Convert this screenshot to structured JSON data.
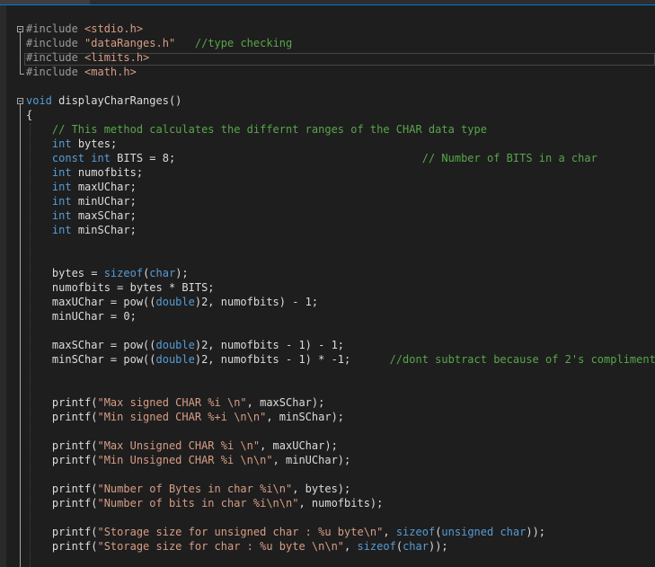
{
  "editor": {
    "language": "c",
    "lines": [
      [
        [
          "pp",
          "#include "
        ],
        [
          "str",
          "<stdio.h>"
        ]
      ],
      [
        [
          "pp",
          "#include "
        ],
        [
          "str",
          "\"dataRanges.h\""
        ],
        [
          "txt",
          "   "
        ],
        [
          "cmt",
          "//type checking"
        ]
      ],
      [
        [
          "pp",
          "#include "
        ],
        [
          "str",
          "<limits.h>"
        ]
      ],
      [
        [
          "pp",
          "#include "
        ],
        [
          "str",
          "<math.h>"
        ]
      ],
      [],
      [
        [
          "kw",
          "void"
        ],
        [
          "txt",
          " displayCharRanges()"
        ]
      ],
      [
        [
          "txt",
          "{"
        ]
      ],
      [
        [
          "txt",
          "    "
        ],
        [
          "cmt",
          "// This method calculates the differnt ranges of the CHAR data type"
        ]
      ],
      [
        [
          "txt",
          "    "
        ],
        [
          "kw",
          "int"
        ],
        [
          "txt",
          " bytes;"
        ]
      ],
      [
        [
          "txt",
          "    "
        ],
        [
          "kw",
          "const"
        ],
        [
          "txt",
          " "
        ],
        [
          "kw",
          "int"
        ],
        [
          "txt",
          " BITS = 8;                                      "
        ],
        [
          "cmt",
          "// Number of BITS in a char"
        ]
      ],
      [
        [
          "txt",
          "    "
        ],
        [
          "kw",
          "int"
        ],
        [
          "txt",
          " numofbits;"
        ]
      ],
      [
        [
          "txt",
          "    "
        ],
        [
          "kw",
          "int"
        ],
        [
          "txt",
          " maxUChar;"
        ]
      ],
      [
        [
          "txt",
          "    "
        ],
        [
          "kw",
          "int"
        ],
        [
          "txt",
          " minUChar;"
        ]
      ],
      [
        [
          "txt",
          "    "
        ],
        [
          "kw",
          "int"
        ],
        [
          "txt",
          " maxSChar;"
        ]
      ],
      [
        [
          "txt",
          "    "
        ],
        [
          "kw",
          "int"
        ],
        [
          "txt",
          " minSChar;"
        ]
      ],
      [],
      [],
      [
        [
          "txt",
          "    bytes = "
        ],
        [
          "kw",
          "sizeof"
        ],
        [
          "txt",
          "("
        ],
        [
          "kw",
          "char"
        ],
        [
          "txt",
          ");"
        ]
      ],
      [
        [
          "txt",
          "    numofbits = bytes * BITS;"
        ]
      ],
      [
        [
          "txt",
          "    maxUChar = pow(("
        ],
        [
          "kw",
          "double"
        ],
        [
          "txt",
          ")2, numofbits) - 1;"
        ]
      ],
      [
        [
          "txt",
          "    minUChar = 0;"
        ]
      ],
      [],
      [
        [
          "txt",
          "    maxSChar = pow(("
        ],
        [
          "kw",
          "double"
        ],
        [
          "txt",
          ")2, numofbits - 1) - 1;"
        ]
      ],
      [
        [
          "txt",
          "    minSChar = pow(("
        ],
        [
          "kw",
          "double"
        ],
        [
          "txt",
          ")2, numofbits - 1) * -1;      "
        ],
        [
          "cmt",
          "//dont subtract because of 2's compliment"
        ]
      ],
      [],
      [],
      [
        [
          "txt",
          "    printf("
        ],
        [
          "str",
          "\"Max signed CHAR %i \\n\""
        ],
        [
          "txt",
          ", maxSChar);"
        ]
      ],
      [
        [
          "txt",
          "    printf("
        ],
        [
          "str",
          "\"Min signed CHAR %+i \\n\\n\""
        ],
        [
          "txt",
          ", minSChar);"
        ]
      ],
      [],
      [
        [
          "txt",
          "    printf("
        ],
        [
          "str",
          "\"Max Unsigned CHAR %i \\n\""
        ],
        [
          "txt",
          ", maxUChar);"
        ]
      ],
      [
        [
          "txt",
          "    printf("
        ],
        [
          "str",
          "\"Min Unsigned CHAR %i \\n\\n\""
        ],
        [
          "txt",
          ", minUChar);"
        ]
      ],
      [],
      [
        [
          "txt",
          "    printf("
        ],
        [
          "str",
          "\"Number of Bytes in char %i\\n\""
        ],
        [
          "txt",
          ", bytes);"
        ]
      ],
      [
        [
          "txt",
          "    printf("
        ],
        [
          "str",
          "\"Number of bits in char %i\\n\\n\""
        ],
        [
          "txt",
          ", numofbits);"
        ]
      ],
      [],
      [
        [
          "txt",
          "    printf("
        ],
        [
          "str",
          "\"Storage size for unsigned char : %u byte\\n\""
        ],
        [
          "txt",
          ", "
        ],
        [
          "kw",
          "sizeof"
        ],
        [
          "txt",
          "("
        ],
        [
          "kw",
          "unsigned"
        ],
        [
          "txt",
          " "
        ],
        [
          "kw",
          "char"
        ],
        [
          "txt",
          "));"
        ]
      ],
      [
        [
          "txt",
          "    printf("
        ],
        [
          "str",
          "\"Storage size for char : %u byte \\n\\n\""
        ],
        [
          "txt",
          ", "
        ],
        [
          "kw",
          "sizeof"
        ],
        [
          "txt",
          "("
        ],
        [
          "kw",
          "char"
        ],
        [
          "txt",
          "));"
        ]
      ]
    ]
  },
  "colors": {
    "background": "#1e1e1e",
    "keyword": "#569cd6",
    "string": "#d69d85",
    "comment": "#57a64a",
    "preprocessor": "#9b9b9b",
    "text": "#dcdcdc"
  }
}
